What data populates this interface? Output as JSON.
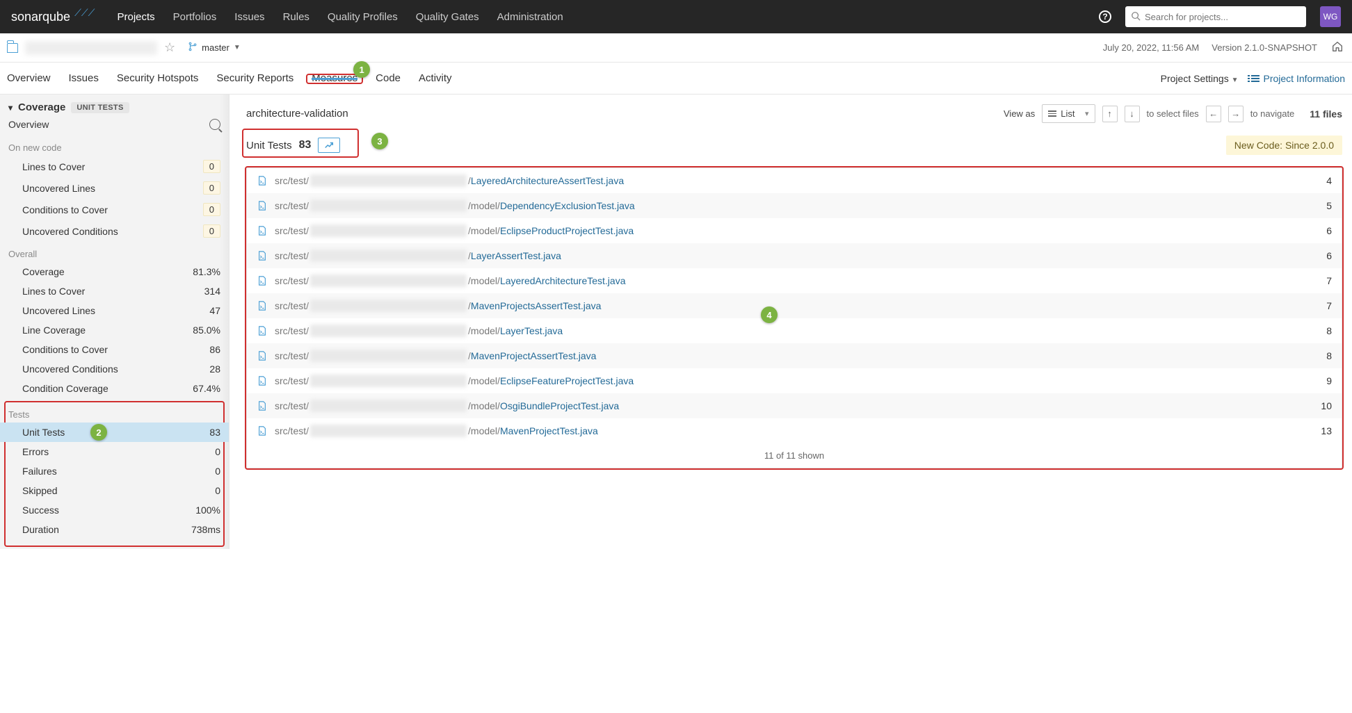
{
  "topnav": {
    "logo": "sonarqube",
    "items": [
      "Projects",
      "Portfolios",
      "Issues",
      "Rules",
      "Quality Profiles",
      "Quality Gates",
      "Administration"
    ],
    "search_placeholder": "Search for projects...",
    "avatar": "WG"
  },
  "project_header": {
    "branch": "master",
    "timestamp": "July 20, 2022, 11:56 AM",
    "version": "Version 2.1.0-SNAPSHOT"
  },
  "project_tabs": {
    "items": [
      "Overview",
      "Issues",
      "Security Hotspots",
      "Security Reports",
      "Measures",
      "Code",
      "Activity"
    ],
    "active": "Measures",
    "settings_label": "Project Settings",
    "info_label": "Project Information"
  },
  "sidebar": {
    "header": "Coverage",
    "badge": "UNIT TESTS",
    "overview_label": "Overview",
    "on_new_code_label": "On new code",
    "on_new_code": [
      {
        "label": "Lines to Cover",
        "value": "0"
      },
      {
        "label": "Uncovered Lines",
        "value": "0"
      },
      {
        "label": "Conditions to Cover",
        "value": "0"
      },
      {
        "label": "Uncovered Conditions",
        "value": "0"
      }
    ],
    "overall_label": "Overall",
    "overall": [
      {
        "label": "Coverage",
        "value": "81.3%"
      },
      {
        "label": "Lines to Cover",
        "value": "314"
      },
      {
        "label": "Uncovered Lines",
        "value": "47"
      },
      {
        "label": "Line Coverage",
        "value": "85.0%"
      },
      {
        "label": "Conditions to Cover",
        "value": "86"
      },
      {
        "label": "Uncovered Conditions",
        "value": "28"
      },
      {
        "label": "Condition Coverage",
        "value": "67.4%"
      }
    ],
    "tests_label": "Tests",
    "tests": [
      {
        "label": "Unit Tests",
        "value": "83",
        "selected": true
      },
      {
        "label": "Errors",
        "value": "0"
      },
      {
        "label": "Failures",
        "value": "0"
      },
      {
        "label": "Skipped",
        "value": "0"
      },
      {
        "label": "Success",
        "value": "100%"
      },
      {
        "label": "Duration",
        "value": "738ms"
      }
    ]
  },
  "content": {
    "breadcrumb": "architecture-validation",
    "viewas_label": "View as",
    "viewas_value": "List",
    "select_hint": "to select files",
    "nav_hint": "to navigate",
    "file_count": "11 files",
    "measure_label": "Unit Tests",
    "measure_value": "83",
    "newcode_badge": "New Code: Since 2.0.0",
    "files": [
      {
        "prefix": "src/test/",
        "mid": "/",
        "name": "LayeredArchitectureAssertTest.java",
        "value": "4"
      },
      {
        "prefix": "src/test/",
        "mid": "/model/",
        "name": "DependencyExclusionTest.java",
        "value": "5"
      },
      {
        "prefix": "src/test/",
        "mid": "/model/",
        "name": "EclipseProductProjectTest.java",
        "value": "6"
      },
      {
        "prefix": "src/test/",
        "mid": "/",
        "name": "LayerAssertTest.java",
        "value": "6"
      },
      {
        "prefix": "src/test/",
        "mid": "/model/",
        "name": "LayeredArchitectureTest.java",
        "value": "7"
      },
      {
        "prefix": "src/test/",
        "mid": "/",
        "name": "MavenProjectsAssertTest.java",
        "value": "7"
      },
      {
        "prefix": "src/test/",
        "mid": "/model/",
        "name": "LayerTest.java",
        "value": "8"
      },
      {
        "prefix": "src/test/",
        "mid": "/",
        "name": "MavenProjectAssertTest.java",
        "value": "8"
      },
      {
        "prefix": "src/test/",
        "mid": "/model/",
        "name": "EclipseFeatureProjectTest.java",
        "value": "9"
      },
      {
        "prefix": "src/test/",
        "mid": "/model/",
        "name": "OsgiBundleProjectTest.java",
        "value": "10"
      },
      {
        "prefix": "src/test/",
        "mid": "/model/",
        "name": "MavenProjectTest.java",
        "value": "13"
      }
    ],
    "footer": "11 of 11 shown"
  },
  "callouts": [
    "1",
    "2",
    "3",
    "4"
  ]
}
